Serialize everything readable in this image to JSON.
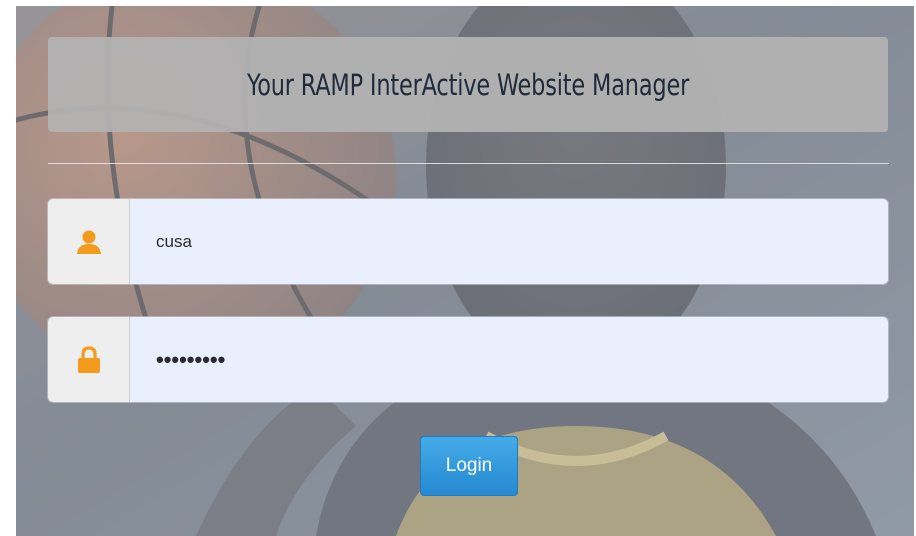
{
  "header": {
    "title": "Your RAMP InterActive Website Manager"
  },
  "login_form": {
    "username": {
      "value": "cusa",
      "icon": "user-icon"
    },
    "password": {
      "value": "•••••••••",
      "icon": "lock-icon"
    },
    "submit_label": "Login"
  },
  "colors": {
    "icon_orange": "#f29b1c",
    "button_blue": "#2f9be0",
    "field_bg": "#e9effd",
    "title_bar": "#b2b2b2"
  }
}
